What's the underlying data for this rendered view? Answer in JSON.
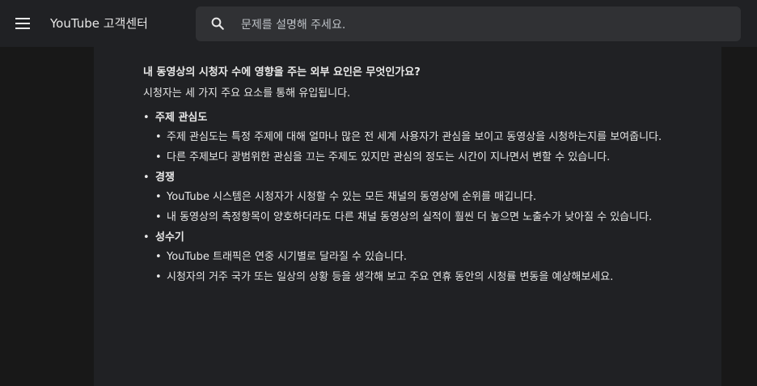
{
  "header": {
    "app_title": "YouTube 고객센터",
    "search_placeholder": "문제를 설명해 주세요."
  },
  "article": {
    "question": "내 동영상의 시청자 수에 영향을 주는 외부 요인은 무엇인가요?",
    "intro": "시청자는 세 가지 주요 요소를 통해 유입됩니다.",
    "factors": [
      {
        "title": "주제 관심도",
        "points": [
          "주제 관심도는 특정 주제에 대해 얼마나 많은 전 세계 사용자가 관심을 보이고 동영상을 시청하는지를 보여줍니다.",
          "다른 주제보다 광범위한 관심을 끄는 주제도 있지만 관심의 정도는 시간이 지나면서 변할 수 있습니다."
        ]
      },
      {
        "title": "경쟁",
        "points": [
          "YouTube 시스템은 시청자가 시청할 수 있는 모든 채널의 동영상에 순위를 매깁니다.",
          "내 동영상의 측정항목이 양호하더라도 다른 채널 동영상의 실적이 훨씬 더 높으면 노출수가 낮아질 수 있습니다."
        ]
      },
      {
        "title": "성수기",
        "points": [
          "YouTube 트래픽은 연중 시기별로 달라질 수 있습니다.",
          "시청자의 거주 국가 또는 일상의 상황 등을 생각해 보고 주요 연휴 동안의 시청률 변동을 예상해보세요."
        ]
      }
    ]
  }
}
